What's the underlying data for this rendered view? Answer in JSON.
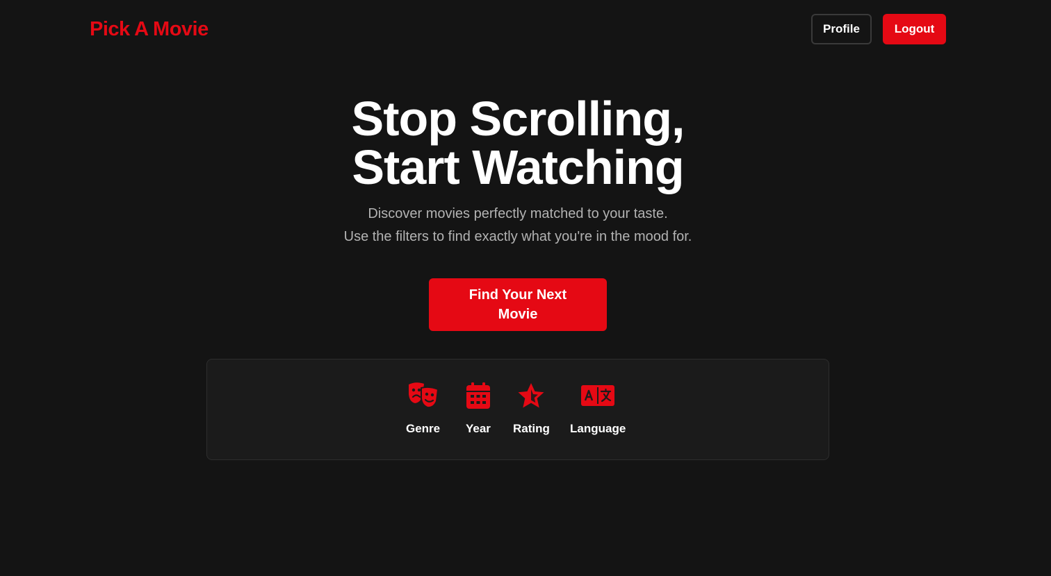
{
  "header": {
    "brand": "Pick A Movie",
    "profile_label": "Profile",
    "logout_label": "Logout"
  },
  "hero": {
    "title_line1": "Stop Scrolling,",
    "title_line2": "Start Watching",
    "subtitle_line1": "Discover movies perfectly matched to your taste.",
    "subtitle_line2": "Use the filters to find exactly what you're in the mood for.",
    "cta_label": "Find Your Next Movie"
  },
  "filters": [
    {
      "label": "Genre",
      "icon": "theater-masks-icon"
    },
    {
      "label": "Year",
      "icon": "calendar-icon"
    },
    {
      "label": "Rating",
      "icon": "star-icon"
    },
    {
      "label": "Language",
      "icon": "language-icon"
    }
  ],
  "colors": {
    "background": "#141414",
    "accent": "#e50914",
    "card": "#1b1b1b",
    "muted_text": "#b3b3b3"
  }
}
